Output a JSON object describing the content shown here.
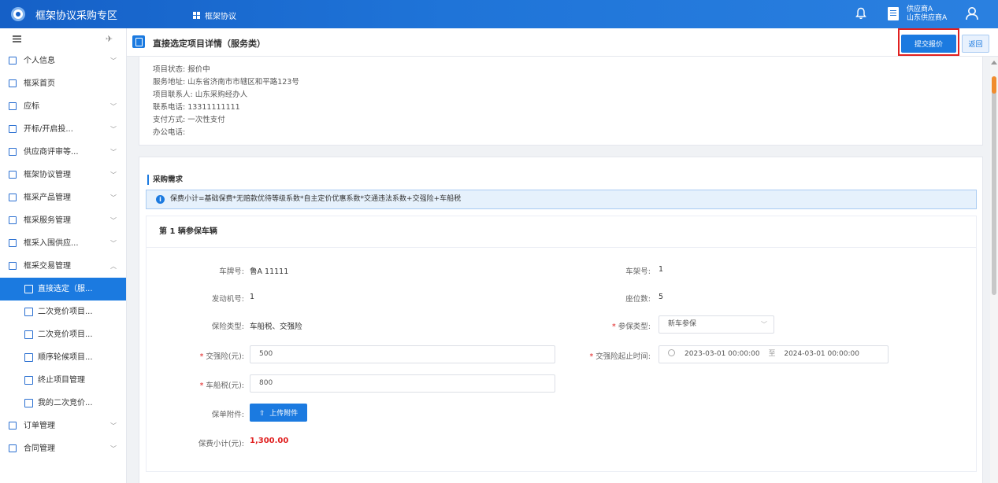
{
  "app": {
    "title": "框架协议采购专区",
    "nav_label": "框架协议",
    "user_line1": "供应商A",
    "user_line2": "山东供应商A"
  },
  "sidebar": {
    "items": [
      {
        "label": "个人信息",
        "icon": "person-card-icon",
        "chevron": "﹀"
      },
      {
        "label": "框采首页",
        "icon": "home-card-icon",
        "chevron": ""
      },
      {
        "label": "应标",
        "icon": "bid-icon",
        "chevron": "﹀"
      },
      {
        "label": "开标/开启投...",
        "icon": "open-bid-icon",
        "chevron": "﹀"
      },
      {
        "label": "供应商评审等...",
        "icon": "review-icon",
        "chevron": "﹀"
      },
      {
        "label": "框架协议管理",
        "icon": "agreement-icon",
        "chevron": "﹀"
      },
      {
        "label": "框采产品管理",
        "icon": "product-icon",
        "chevron": "﹀"
      },
      {
        "label": "框采服务管理",
        "icon": "service-icon",
        "chevron": "﹀"
      },
      {
        "label": "框采入围供应...",
        "icon": "supplier-icon",
        "chevron": "﹀"
      },
      {
        "label": "框采交易管理",
        "icon": "trade-icon",
        "chevron": "︿"
      }
    ],
    "sub_items": [
      {
        "label": "直接选定（服...",
        "icon": "direct-select-icon",
        "active": true
      },
      {
        "label": "二次竞价项目...",
        "icon": "bidding-icon",
        "active": false
      },
      {
        "label": "二次竞价项目...",
        "icon": "bidding-users-icon",
        "active": false
      },
      {
        "label": "顺序轮候项目...",
        "icon": "queue-icon",
        "active": false
      },
      {
        "label": "终止项目管理",
        "icon": "terminate-icon",
        "active": false
      },
      {
        "label": "我的二次竞价...",
        "icon": "my-bidding-icon",
        "active": false
      }
    ],
    "bottom_items": [
      {
        "label": "订单管理",
        "icon": "order-icon",
        "chevron": "﹀"
      },
      {
        "label": "合同管理",
        "icon": "contract-icon",
        "chevron": "﹀"
      }
    ]
  },
  "header": {
    "title": "直接选定项目详情（服务类）",
    "submit_label": "提交报价",
    "back_label": "返回"
  },
  "info": {
    "status": "项目状态:  报价中",
    "address": "服务地址:  山东省济南市市辖区和平路123号",
    "contact": "项目联系人:  山东采购经办人",
    "phone": "联系电话:  13311111111",
    "payment": "支付方式:  一次性支付",
    "office_phone": "办公电话:"
  },
  "requirements": {
    "section_title": "采购需求",
    "alert": "保费小计=基础保费*无赔款优待等级系数*自主定价优惠系数*交通违法系数+交强险+车船税",
    "vehicle_title": "第 1 辆参保车辆",
    "plate_label": "车牌号:",
    "plate_value": "鲁A 11111",
    "frame_label": "车架号:",
    "frame_value": "1",
    "engine_label": "发动机号:",
    "engine_value": "1",
    "seats_label": "座位数:",
    "seats_value": "5",
    "insurance_type_label": "保险类型:",
    "insurance_type_value": "车船税、交强险",
    "insure_type_label": "参保类型:",
    "insure_type_value": "新车参保",
    "compulsory_label": "交强险(元):",
    "compulsory_value": "500",
    "period_label": "交强险起止时间:",
    "period_start": "2023-03-01 00:00:00",
    "period_sep": "至",
    "period_end": "2024-03-01 00:00:00",
    "vessel_tax_label": "车船税(元):",
    "vessel_tax_value": "800",
    "attachment_label": "保单附件:",
    "upload_label": "上传附件",
    "subtotal_label": "保费小计(元):",
    "subtotal_value": "1,300.00"
  }
}
